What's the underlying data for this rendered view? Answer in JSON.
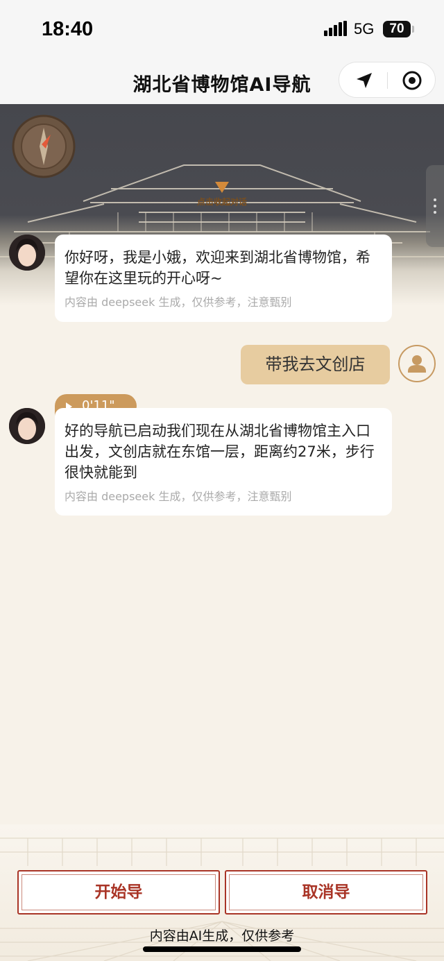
{
  "status_bar": {
    "time": "18:40",
    "network": "5G",
    "battery": "70"
  },
  "header": {
    "title": "湖北省博物馆AI导航",
    "icons": [
      "navigation-arrow-icon",
      "target-icon"
    ]
  },
  "scene": {
    "collapse_label": "点击收起对话",
    "compass_icon": "compass-icon"
  },
  "messages": [
    {
      "role": "assistant",
      "text": "你好呀，我是小娥，欢迎来到湖北省博物馆，希望你在这里玩的开心呀~",
      "note": "内容由 deepseek 生成，仅供参考，注意甄别"
    },
    {
      "role": "user",
      "text": "带我去文创店"
    },
    {
      "role": "assistant",
      "voice_duration": "0'11\"",
      "text": "好的导航已启动我们现在从湖北省博物馆主入口出发，文创店就在东馆一层，距离约27米，步行很快就能到",
      "note": "内容由 deepseek 生成，仅供参考，注意甄别"
    }
  ],
  "actions": {
    "start_label": "开始导",
    "cancel_label": "取消导"
  },
  "footer": {
    "disclaimer": "内容由AI生成，仅供参考"
  },
  "colors": {
    "accent_red": "#a93426",
    "voice_tab": "#cc9a5c",
    "user_bubble": "#e7cca0",
    "background": "#f7f2e9"
  }
}
